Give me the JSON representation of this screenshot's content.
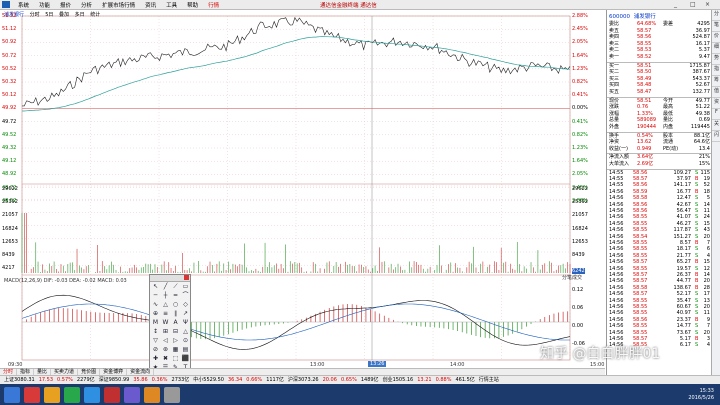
{
  "menubar": {
    "items": [
      "系统",
      "功能",
      "报价",
      "分析",
      "扩展市场行情",
      "资讯",
      "工具",
      "帮助"
    ],
    "active": "行情",
    "center": "通达信金融终端 通达信",
    "controls": [
      "_",
      "□",
      "×"
    ]
  },
  "chart": {
    "header": [
      "浦发银行",
      "分时",
      "5日",
      "叠加",
      "多日",
      "统计"
    ],
    "left_prices": [
      {
        "v": "51.32",
        "c": "red"
      },
      {
        "v": "51.12",
        "c": "red"
      },
      {
        "v": "50.92",
        "c": "red"
      },
      {
        "v": "50.72",
        "c": "red"
      },
      {
        "v": "50.52",
        "c": "red"
      },
      {
        "v": "50.32",
        "c": "red"
      },
      {
        "v": "50.12",
        "c": "red"
      },
      {
        "v": "49.92",
        "c": "red"
      },
      {
        "v": "49.72",
        "c": ""
      },
      {
        "v": "49.52",
        "c": "grn"
      },
      {
        "v": "49.32",
        "c": "grn"
      },
      {
        "v": "49.12",
        "c": "grn"
      },
      {
        "v": "48.92",
        "c": "grn"
      },
      {
        "v": "48.72",
        "c": "grn"
      },
      {
        "v": "48.52",
        "c": "grn"
      }
    ],
    "right_pcts": [
      {
        "v": "2.88%",
        "c": "red"
      },
      {
        "v": "2.45%",
        "c": "red"
      },
      {
        "v": "2.05%",
        "c": "red"
      },
      {
        "v": "1.64%",
        "c": "red"
      },
      {
        "v": "1.23%",
        "c": "red"
      },
      {
        "v": "0.82%",
        "c": "red"
      },
      {
        "v": "0.41%",
        "c": "red"
      },
      {
        "v": "0.00%",
        "c": ""
      },
      {
        "v": "0.41%",
        "c": "grn"
      },
      {
        "v": "0.82%",
        "c": "grn"
      },
      {
        "v": "1.23%",
        "c": "grn"
      },
      {
        "v": "1.64%",
        "c": "grn"
      },
      {
        "v": "2.05%",
        "c": "grn"
      },
      {
        "v": "2.45%",
        "c": "grn"
      },
      {
        "v": "2.88%",
        "c": "grn"
      }
    ],
    "vol_labels": [
      "29622",
      "25392",
      "21057",
      "16824",
      "12653",
      "8439",
      "4217"
    ],
    "vol_right": [
      "29622",
      "25392",
      "21057",
      "16824",
      "12653",
      "8439"
    ],
    "vol_hl": "6242",
    "macd_header": "MACD(12,26,9) DIF: -0.03 DEA: -0.02 MACD: 0.03",
    "macd_right": [
      "0.12",
      "0.06",
      "0.00",
      "-0.06"
    ],
    "macd_tag": "分笔成交",
    "times": [
      "09:30",
      "10:30",
      "13:00",
      "14:00",
      "15:00"
    ],
    "time_cursor": "13:26"
  },
  "bottom_tabs": [
    "分时",
    "指标",
    "量比",
    "买卖力道",
    "竞价图",
    "资金博弈",
    "资金流向"
  ],
  "statusbar": [
    "上证3080.31",
    "17.53",
    "0.57%",
    "2279亿",
    "深证9850.99",
    "35.86",
    "0.36%",
    "2733亿",
    "中小5529.50",
    "36.34",
    "0.66%",
    "1117亿",
    "沪深3073.26",
    "20.06",
    "0.65%",
    "1489亿",
    "创业1505.16",
    "13.21",
    "0.88%",
    "461.5亿",
    "行情主站"
  ],
  "clock": {
    "time": "15:33",
    "date": "2016/5/26"
  },
  "side": {
    "code": "600000",
    "name": "浦发银行",
    "top": [
      {
        "a": "委比",
        "b": "64.68%",
        "d": "委差",
        "e": "4295"
      },
      {
        "a": "卖五",
        "b": "58.57",
        "e": "36.97"
      },
      {
        "a": "卖四",
        "b": "58.56",
        "e": "524.87"
      },
      {
        "a": "卖三",
        "b": "58.55",
        "e": "16.17"
      },
      {
        "a": "卖二",
        "b": "58.53",
        "e": "5.37"
      },
      {
        "a": "卖一",
        "b": "58.52",
        "e": "9.47"
      }
    ],
    "buy": [
      {
        "a": "买一",
        "b": "58.51",
        "e": "1715.87"
      },
      {
        "a": "买二",
        "b": "58.50",
        "e": "387.67"
      },
      {
        "a": "买三",
        "b": "58.49",
        "e": "543.37"
      },
      {
        "a": "买四",
        "b": "58.48",
        "e": "52.67"
      },
      {
        "a": "买五",
        "b": "58.47",
        "e": "132.77"
      }
    ],
    "stats": [
      {
        "a": "现价",
        "b": "58.51",
        "d": "今开",
        "e": "49.77"
      },
      {
        "a": "涨跌",
        "b": "0.76",
        "d": "最高",
        "e": "51.22"
      },
      {
        "a": "涨幅",
        "b": "1.33%",
        "d": "最低",
        "e": "49.38"
      },
      {
        "a": "总量",
        "b": "589089",
        "d": "量比",
        "e": "0.69"
      },
      {
        "a": "外盘",
        "b": "190444",
        "d": "内盘",
        "e": "119445"
      }
    ],
    "stats2": [
      {
        "a": "换手",
        "b": "0.54%",
        "d": "股本",
        "e": "88.1亿"
      },
      {
        "a": "净资",
        "b": "13.62",
        "d": "流通",
        "e": "64.6亿"
      },
      {
        "a": "收益(一)",
        "b": "0.949",
        "d": "PE(动)",
        "e": "13.4"
      }
    ],
    "flows": [
      {
        "a": "净流入额",
        "b": "3.64亿",
        "e": "21%"
      },
      {
        "a": "大单流入",
        "b": "2.69亿",
        "e": "15%"
      }
    ],
    "ticks": [
      {
        "t": "14:55",
        "p": "58.56",
        "v": "109.27",
        "bs": "S",
        "n": "115"
      },
      {
        "t": "14:55",
        "p": "58.57",
        "v": "37.97",
        "bs": "B",
        "n": "19"
      },
      {
        "t": "14:55",
        "p": "58.56",
        "v": "141.17",
        "bs": "S",
        "n": "52"
      },
      {
        "t": "14:56",
        "p": "58.59",
        "v": "16.77",
        "bs": "B",
        "n": "18"
      },
      {
        "t": "14:56",
        "p": "58.58",
        "v": "12.47",
        "bs": "S",
        "n": "5"
      },
      {
        "t": "14:56",
        "p": "58.56",
        "v": "42.67",
        "bs": "S",
        "n": "14"
      },
      {
        "t": "14:56",
        "p": "58.56",
        "v": "56.47",
        "bs": "S",
        "n": "11"
      },
      {
        "t": "14:56",
        "p": "58.55",
        "v": "41.07",
        "bs": "S",
        "n": "24"
      },
      {
        "t": "14:56",
        "p": "58.55",
        "v": "46.27",
        "bs": "S",
        "n": "15"
      },
      {
        "t": "14:56",
        "p": "58.55",
        "v": "117.87",
        "bs": "S",
        "n": "43"
      },
      {
        "t": "14:56",
        "p": "58.54",
        "v": "151.27",
        "bs": "S",
        "n": "20"
      },
      {
        "t": "14:56",
        "p": "58.55",
        "v": "8.57",
        "bs": "B",
        "n": "7"
      },
      {
        "t": "14:56",
        "p": "58.55",
        "v": "18.17",
        "bs": "S",
        "n": "6"
      },
      {
        "t": "14:56",
        "p": "58.55",
        "v": "21.77",
        "bs": "S",
        "n": "4"
      },
      {
        "t": "14:56",
        "p": "58.57",
        "v": "65.27",
        "bs": "B",
        "n": "15"
      },
      {
        "t": "14:56",
        "p": "58.55",
        "v": "19.57",
        "bs": "S",
        "n": "12"
      },
      {
        "t": "14:56",
        "p": "58.57",
        "v": "26.37",
        "bs": "B",
        "n": "14"
      },
      {
        "t": "14:56",
        "p": "58.57",
        "v": "44.77",
        "bs": "B",
        "n": "20"
      },
      {
        "t": "14:56",
        "p": "58.58",
        "v": "138.67",
        "bs": "B",
        "n": "28"
      },
      {
        "t": "14:56",
        "p": "58.57",
        "v": "52.17",
        "bs": "S",
        "n": "17"
      },
      {
        "t": "14:56",
        "p": "58.55",
        "v": "35.47",
        "bs": "S",
        "n": "13"
      },
      {
        "t": "14:56",
        "p": "58.55",
        "v": "60.67",
        "bs": "S",
        "n": "20"
      },
      {
        "t": "14:56",
        "p": "58.55",
        "v": "40.97",
        "bs": "S",
        "n": "11"
      },
      {
        "t": "14:56",
        "p": "58.56",
        "v": "23.37",
        "bs": "B",
        "n": "9"
      },
      {
        "t": "14:56",
        "p": "58.55",
        "v": "14.77",
        "bs": "S",
        "n": "7"
      },
      {
        "t": "14:56",
        "p": "58.55",
        "v": "73.67",
        "bs": "S",
        "n": "20"
      },
      {
        "t": "14:56",
        "p": "58.57",
        "v": "5.17",
        "bs": "B",
        "n": "3"
      },
      {
        "t": "14:56",
        "p": "58.55",
        "v": "6.17",
        "bs": "S",
        "n": "4"
      }
    ]
  },
  "rightstrip": [
    "分",
    "笔",
    "价",
    "细",
    "势",
    "指",
    "筹",
    "值",
    "资",
    "F",
    "关",
    "闪"
  ],
  "watermark": "知乎 @白白胖胖01",
  "toolbox_icons": [
    "↖",
    "╱",
    "⟋",
    "▭",
    "─",
    "┼",
    "═",
    "⌒",
    "∿",
    "△",
    "○",
    "◇",
    "⊕",
    "≡",
    "∥",
    "↗",
    "M",
    "W",
    "A",
    "Ψ",
    "↕",
    "⊞",
    "⊟",
    "△",
    "▽",
    "◁",
    "▷",
    "⊙",
    "⊘",
    "⊛",
    "▦",
    "▤",
    "✚",
    "✖",
    "⬚",
    "⬛",
    "★",
    "☰",
    "✎",
    "T"
  ]
}
